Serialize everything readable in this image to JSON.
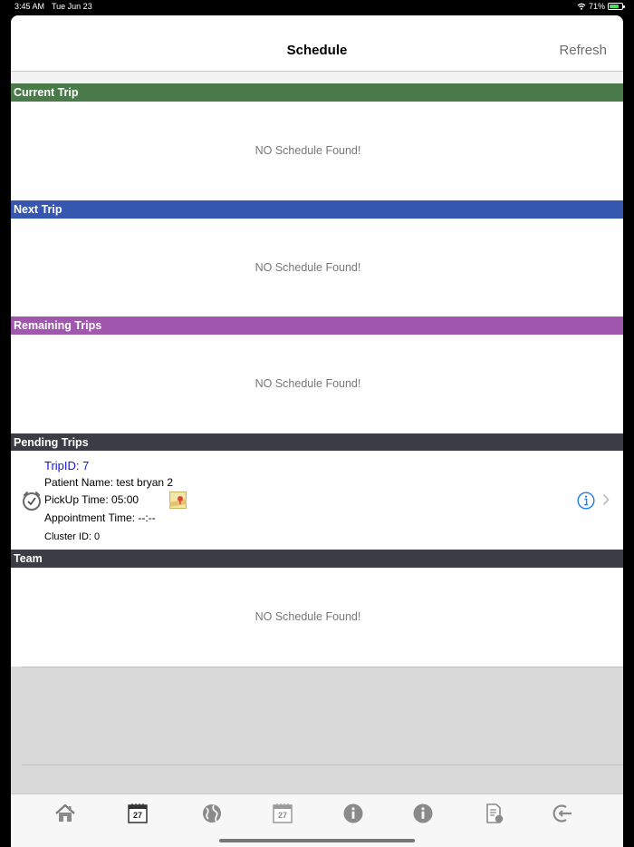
{
  "status_bar": {
    "time": "3:45 AM",
    "date": "Tue Jun 23",
    "battery": "71%",
    "battery_level": 0.71
  },
  "navbar": {
    "title": "Schedule",
    "refresh_label": "Refresh"
  },
  "sections": {
    "current": {
      "title": "Current Trip",
      "color": "#4a7a4a",
      "empty": "NO Schedule Found!"
    },
    "next": {
      "title": "Next Trip",
      "color": "#3557b0",
      "empty": "NO Schedule Found!"
    },
    "remaining": {
      "title": "Remaining Trips",
      "color": "#a157ae",
      "empty": "NO Schedule Found!"
    },
    "pending": {
      "title": "Pending Trips",
      "color": "#3c3c44"
    },
    "team": {
      "title": "Team",
      "color": "#3c3c44",
      "empty": "NO Schedule Found!"
    }
  },
  "pending_trip": {
    "trip_id": "TripID: 7",
    "patient_name": "Patient Name: test bryan 2",
    "pickup_time": "PickUp Time: 05:00",
    "appointment_time": "Appointment Time: --:--",
    "cluster_id": "Cluster ID: 0"
  },
  "tabs": [
    {
      "icon": "home-icon"
    },
    {
      "icon": "calendar-today-icon",
      "label": "27"
    },
    {
      "icon": "globe-icon"
    },
    {
      "icon": "calendar-icon",
      "label": "27"
    },
    {
      "icon": "info-icon"
    },
    {
      "icon": "info-icon"
    },
    {
      "icon": "document-icon"
    },
    {
      "icon": "logout-icon"
    }
  ],
  "colors": {
    "accent_blue": "#1e7cf2",
    "trip_id_blue": "#1414e6"
  }
}
